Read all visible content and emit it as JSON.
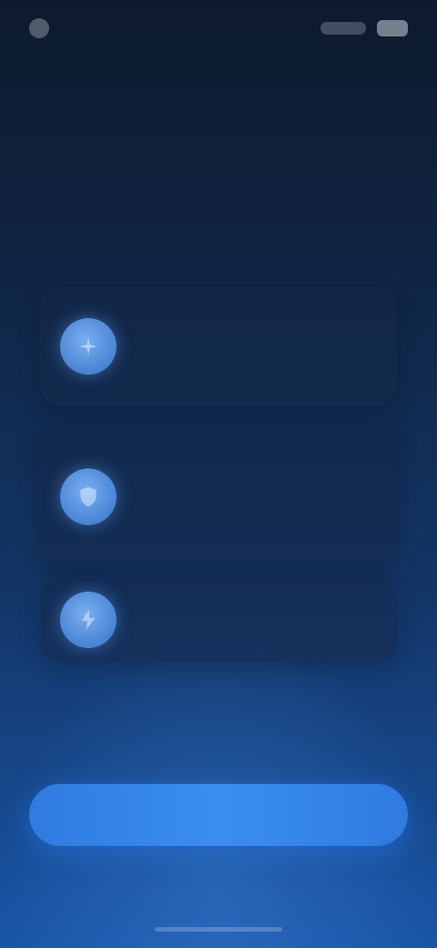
{
  "status_bar": {
    "time": "",
    "indicators": ""
  },
  "header": {
    "title": "",
    "subtitle": ""
  },
  "features": [
    {
      "icon": "sparkle-icon",
      "title": "",
      "description": ""
    },
    {
      "icon": "shield-icon",
      "title": "",
      "description": ""
    },
    {
      "icon": "bolt-icon",
      "title": "",
      "description": ""
    }
  ],
  "primary_button": {
    "label": ""
  },
  "colors": {
    "background_top": "#0e1a2c",
    "background_bottom": "#1a56a8",
    "accent": "#3a8ef0",
    "icon_fill": "#6ea4ec"
  }
}
